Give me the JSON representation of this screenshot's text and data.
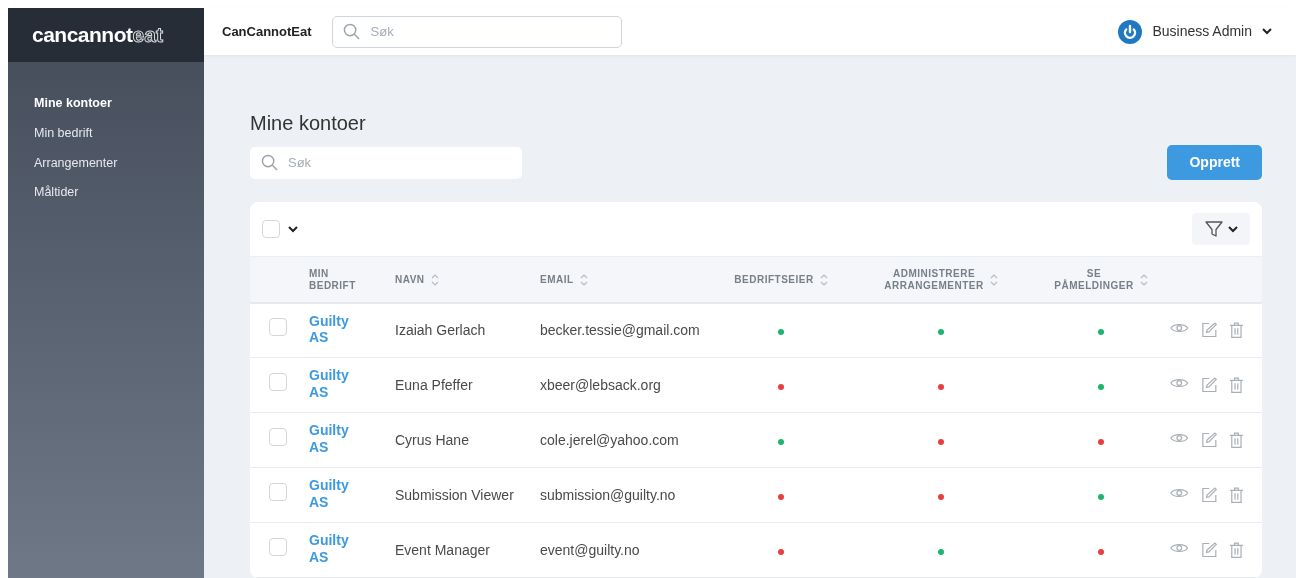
{
  "logo": {
    "bold": "cancannot",
    "outline": "eat"
  },
  "sidebar": {
    "items": [
      {
        "label": "Mine kontoer",
        "selected": true
      },
      {
        "label": "Min bedrift",
        "selected": false
      },
      {
        "label": "Arrangementer",
        "selected": false
      },
      {
        "label": "Måltider",
        "selected": false
      }
    ]
  },
  "topbar": {
    "brand": "CanCannotEat",
    "search": {
      "placeholder": "Søk"
    },
    "user": "Business Admin"
  },
  "page": {
    "title": "Mine kontoer",
    "search": {
      "placeholder": "Søk"
    },
    "create_button": "Opprett"
  },
  "table": {
    "select_all": {
      "checked": false
    },
    "columns": [
      {
        "label": "MIN BEDRIFT",
        "sortable": false
      },
      {
        "label": "NAVN",
        "sortable": true
      },
      {
        "label": "EMAIL",
        "sortable": true
      },
      {
        "label": "BEDRIFTSEIER",
        "sortable": true
      },
      {
        "label": "ADMINISTRERE ARRANGEMENTER",
        "sortable": true
      },
      {
        "label": "SE PÅMELDINGER",
        "sortable": true
      }
    ],
    "rows": [
      {
        "selected": false,
        "company": "Guilty AS",
        "name": "Izaiah Gerlach",
        "email": "becker.tessie@gmail.com",
        "owner": true,
        "manage_events": true,
        "see_registrations": true
      },
      {
        "selected": false,
        "company": "Guilty AS",
        "name": "Euna Pfeffer",
        "email": "xbeer@lebsack.org",
        "owner": false,
        "manage_events": false,
        "see_registrations": true
      },
      {
        "selected": false,
        "company": "Guilty AS",
        "name": "Cyrus Hane",
        "email": "cole.jerel@yahoo.com",
        "owner": true,
        "manage_events": false,
        "see_registrations": false
      },
      {
        "selected": false,
        "company": "Guilty AS",
        "name": "Submission Viewer",
        "email": "submission@guilty.no",
        "owner": false,
        "manage_events": false,
        "see_registrations": true
      },
      {
        "selected": false,
        "company": "Guilty AS",
        "name": "Event Manager",
        "email": "event@guilty.no",
        "owner": false,
        "manage_events": true,
        "see_registrations": false
      }
    ]
  }
}
